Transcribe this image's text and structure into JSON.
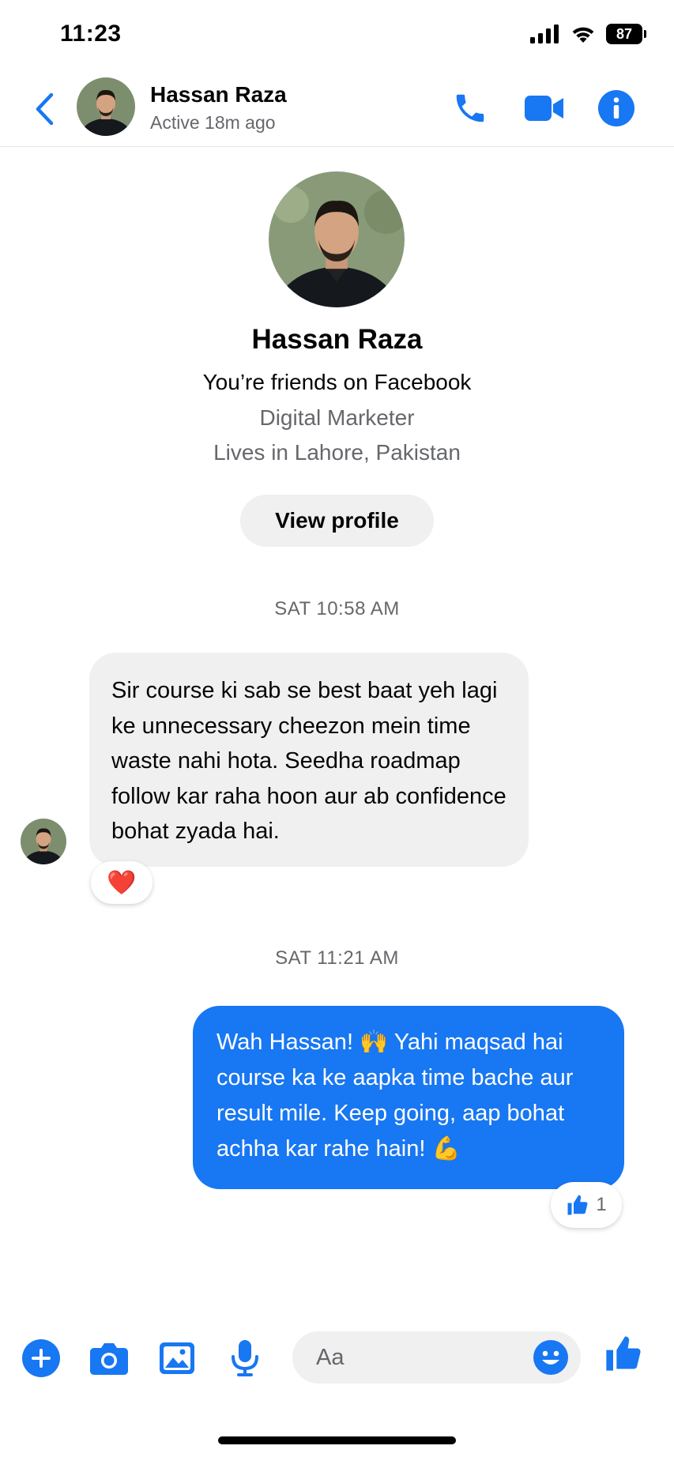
{
  "status_bar": {
    "time": "11:23",
    "battery": "87"
  },
  "header": {
    "name": "Hassan Raza",
    "status": "Active 18m ago"
  },
  "profile": {
    "name": "Hassan Raza",
    "friendship": "You’re friends on Facebook",
    "occupation": "Digital Marketer",
    "location": "Lives in Lahore, Pakistan",
    "view_profile_label": "View profile"
  },
  "messages": [
    {
      "timestamp": "SAT 10:58 AM",
      "direction": "incoming",
      "text": "Sir course ki sab se best baat yeh lagi ke unnecessary cheezon mein time waste nahi hota. Seedha roadmap follow kar raha hoon aur ab confidence bohat zyada hai.",
      "reaction": "❤️"
    },
    {
      "timestamp": "SAT 11:21 AM",
      "direction": "outgoing",
      "text": "Wah Hassan! 🙌 Yahi maqsad hai course ka ke aapka time bache aur result mile. Keep going, aap bohat achha kar rahe hain! 💪",
      "reaction": "like",
      "reaction_count": "1"
    }
  ],
  "composer": {
    "placeholder": "Aa"
  },
  "colors": {
    "accent": "#1877f2",
    "incoming_bubble": "#f0f0f0",
    "heart": "#e41e3f"
  },
  "icons": [
    "back-chevron-icon",
    "phone-icon",
    "video-icon",
    "info-icon",
    "plus-icon",
    "camera-icon",
    "image-icon",
    "microphone-icon",
    "emoji-icon",
    "thumbs-up-icon"
  ]
}
